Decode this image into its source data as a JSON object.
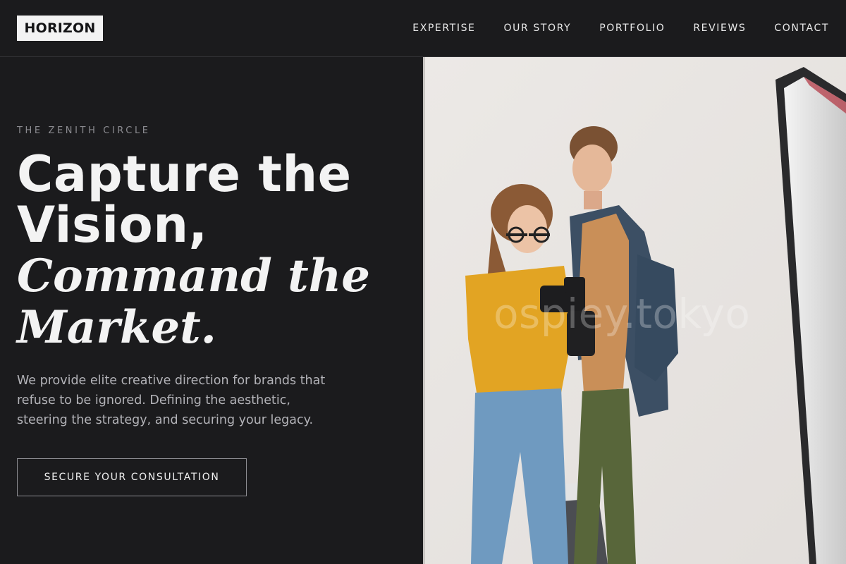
{
  "header": {
    "logo": "HORIZON",
    "nav": [
      "EXPERTISE",
      "OUR STORY",
      "PORTFOLIO",
      "REVIEWS",
      "CONTACT"
    ]
  },
  "hero": {
    "eyebrow": "THE ZENITH CIRCLE",
    "headline_sans_1": "Capture the",
    "headline_sans_2": "Vision,",
    "headline_serif_1": "Command the",
    "headline_serif_2": "Market.",
    "intro": "We provide elite creative direction for brands that refuse to be ignored. Defining the aesthetic, steering the strategy, and securing your legacy.",
    "cta_label": "SECURE YOUR CONSULTATION"
  },
  "image": {
    "watermark": "ospiey.tokyo"
  },
  "colors": {
    "background": "#1b1b1d",
    "text": "#f3f3f3",
    "muted": "#b3b3b8",
    "backdrop": "#e9e6e4"
  }
}
